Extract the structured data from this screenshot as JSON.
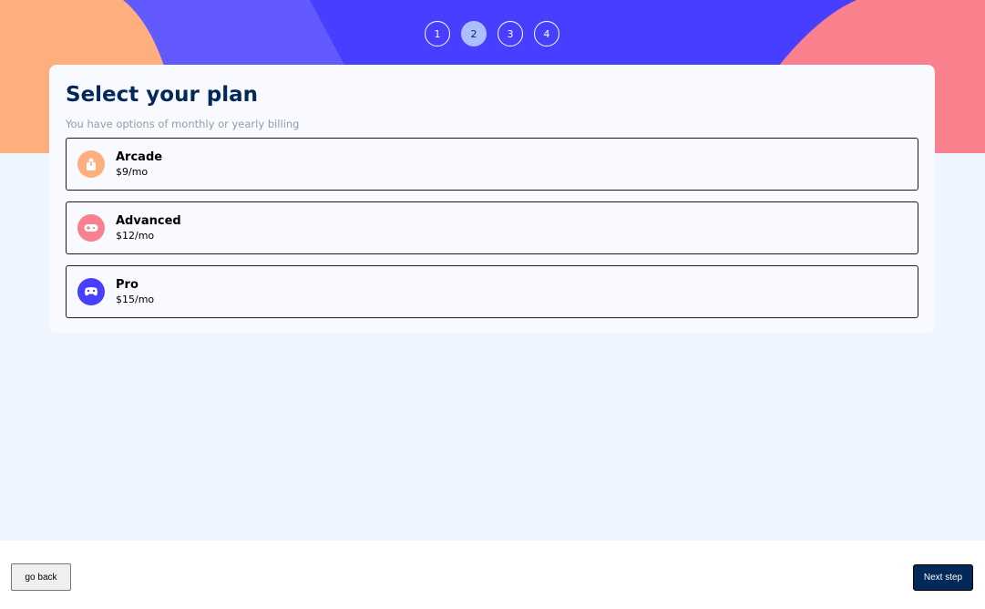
{
  "steps": [
    {
      "number": "1",
      "active": false
    },
    {
      "number": "2",
      "active": true
    },
    {
      "number": "3",
      "active": false
    },
    {
      "number": "4",
      "active": false
    }
  ],
  "card": {
    "title": "Select your plan",
    "subtitle": "You have options of monthly or yearly billing"
  },
  "plans": [
    {
      "name": "Arcade",
      "price": "$9/mo",
      "icon": "arcade-icon",
      "color": "#ffaf7e"
    },
    {
      "name": "Advanced",
      "price": "$12/mo",
      "icon": "gamepad-icon",
      "color": "#f9818e"
    },
    {
      "name": "Pro",
      "price": "$15/mo",
      "icon": "controller-icon",
      "color": "#483eff"
    }
  ],
  "footer": {
    "back_label": "go back",
    "next_label": "Next step"
  },
  "colors": {
    "hero_blue": "#483eff",
    "hero_light_blue": "#6259ff",
    "hero_orange": "#ffaf7e",
    "hero_pink": "#f9818e",
    "denim": "#02295a",
    "page_bg": "#eff5ff"
  }
}
